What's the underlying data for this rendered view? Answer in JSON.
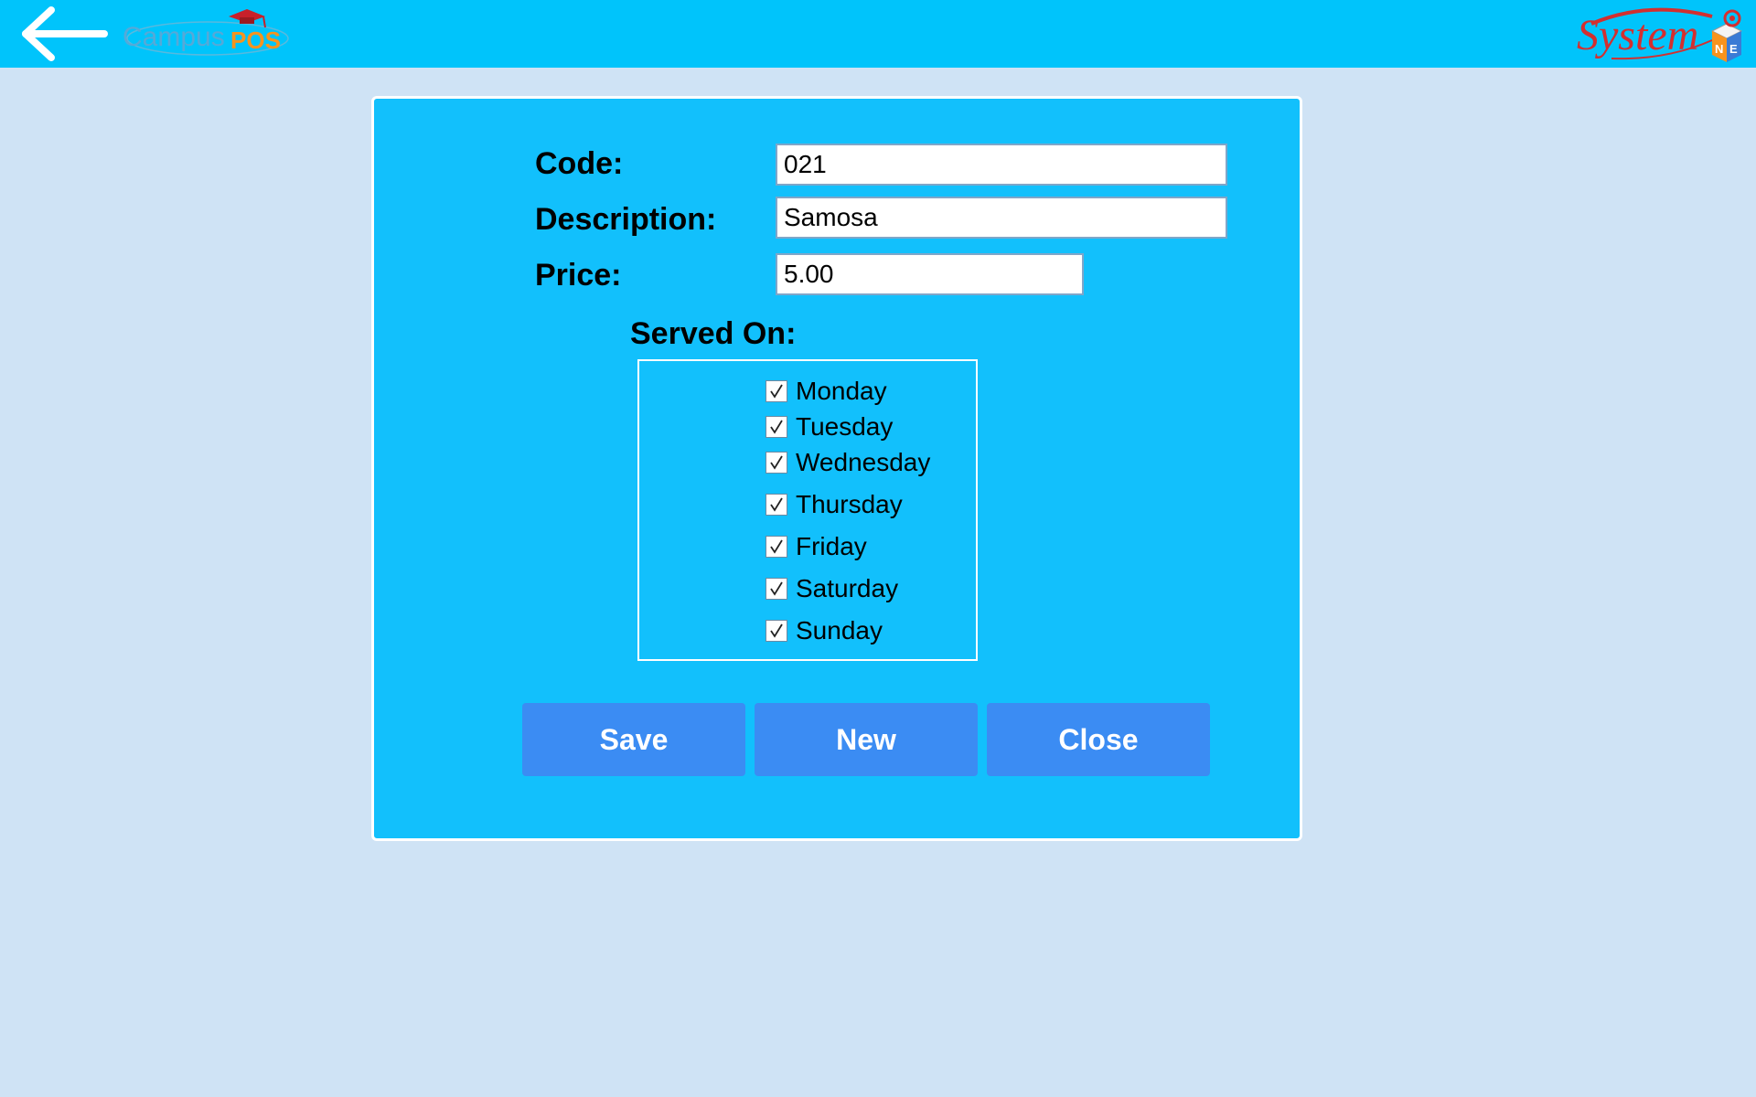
{
  "header": {
    "campus_logo": {
      "text_campus": "Campus",
      "text_pos": "POS"
    },
    "brand_logo": {
      "text": "System",
      "letters": [
        "N",
        "E"
      ]
    },
    "colors": {
      "bar": "#00c4fb"
    }
  },
  "form": {
    "code": {
      "label": "Code:",
      "value": "021"
    },
    "description": {
      "label": "Description:",
      "value": "Samosa"
    },
    "price": {
      "label": "Price:",
      "value": "5.00"
    },
    "served_on": {
      "label": "Served On:",
      "days": [
        {
          "label": "Monday",
          "checked": true
        },
        {
          "label": "Tuesday",
          "checked": true
        },
        {
          "label": "Wednesday",
          "checked": true
        },
        {
          "label": "Thursday",
          "checked": true
        },
        {
          "label": "Friday",
          "checked": true
        },
        {
          "label": "Saturday",
          "checked": true
        },
        {
          "label": "Sunday",
          "checked": true
        }
      ]
    }
  },
  "buttons": {
    "save": "Save",
    "new": "New",
    "close": "Close"
  },
  "colors": {
    "page_bg": "#cfe3f5",
    "panel_bg": "#12c0fc",
    "button_bg": "#3b8cf3"
  }
}
